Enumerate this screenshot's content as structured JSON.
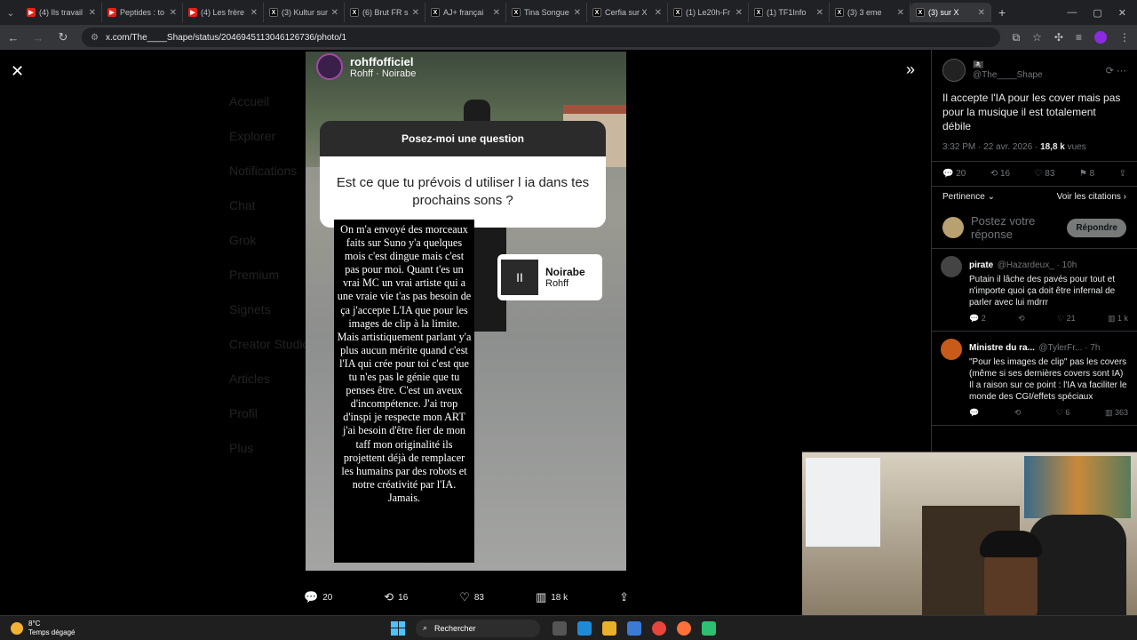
{
  "browser": {
    "tabs": [
      {
        "title": "(4) Ils travail",
        "icon": "youtube-icon"
      },
      {
        "title": "Peptides : to",
        "icon": "youtube-icon"
      },
      {
        "title": "(4) Les frère",
        "icon": "youtube-icon"
      },
      {
        "title": "(3) Kultur sur",
        "icon": "x-icon"
      },
      {
        "title": "(6) Brut FR s",
        "icon": "x-icon"
      },
      {
        "title": "AJ+ françai",
        "icon": "x-icon"
      },
      {
        "title": "Tina Songue",
        "icon": "x-icon"
      },
      {
        "title": "Cerfia sur X",
        "icon": "x-icon"
      },
      {
        "title": "(1) Le20h-Fr",
        "icon": "x-icon"
      },
      {
        "title": "(1) TF1Info",
        "icon": "x-icon"
      },
      {
        "title": "(3) 3 eme",
        "icon": "x-icon"
      },
      {
        "title": "(3) sur X",
        "icon": "x-icon",
        "active": true
      }
    ],
    "url": "x.com/The____Shape/status/2046945113046126736/photo/1"
  },
  "background_nav": [
    "Accueil",
    "Explorer",
    "Notifications",
    "Chat",
    "Grok",
    "Premium",
    "Signets",
    "Creator Studio",
    "Articles",
    "Profil",
    "Plus"
  ],
  "media": {
    "ig_user": "rohffofficiel",
    "ig_song_line": "Rohff · Noirabe",
    "question_header": "Posez-moi une question",
    "question": "Est ce que tu prévois d utiliser l ia dans tes prochains sons ?",
    "answer": "On m'a envoyé des morceaux faits sur Suno y'a quelques mois c'est dingue mais c'est pas pour moi. Quant t'es un vrai MC un vrai artiste qui a une vraie vie t'as pas besoin de ça j'accepte L'IA que pour les images de clip à la limite. Mais artistiquement parlant y'a plus aucun mérite quand c'est l'IA qui crée pour toi c'est que tu n'es pas le génie que tu penses être. C'est un aveux d'incompétence. J'ai trop d'inspi je respecte mon ART j'ai besoin d'être fier de mon taff mon originalité ils projettent déjà de remplacer les humains par des robots et notre créativité par l'IA. Jamais.",
    "song_title": "Noirabe",
    "song_artist": "Rohff"
  },
  "media_actions": {
    "replies": "20",
    "reposts": "16",
    "likes": "83",
    "views": "18 k"
  },
  "post": {
    "author_name": "🏴‍☠️",
    "author_handle": "@The____Shape",
    "text": "Il accepte l'IA pour les cover mais pas pour la musique il est totalement débile",
    "time": "3:32 PM · 22 avr. 2026 · ",
    "views": "18,8 k",
    "views_label": " vues",
    "stats": {
      "replies": "20",
      "reposts": "16",
      "likes": "83",
      "bookmarks": "8"
    },
    "sort_label": "Pertinence",
    "quotes_label": "Voir les citations",
    "compose_placeholder": "Postez votre réponse",
    "reply_button": "Répondre"
  },
  "replies": [
    {
      "name": "pirate",
      "handle": "@Hazardeux_ · 10h",
      "text": "Putain il lâche des pavés pour tout et n'importe quoi ça doit être infernal de parler avec lui mdrrr",
      "stats": [
        "2",
        "",
        "21",
        "1 k"
      ],
      "color": "#444"
    },
    {
      "name": "Ministre du ra...",
      "handle": "@TylerFr... · 7h",
      "text": "\"Pour les images de clip\" pas les covers (même si ses dernières covers sont IA)\nIl a raison sur ce point : l'IA va faciliter le monde des CGI/effets spéciaux",
      "stats": [
        "",
        "",
        "6",
        "363"
      ],
      "color": "#c85a1a"
    }
  ],
  "taskbar": {
    "temp": "8°C",
    "weather": "Temps dégagé",
    "search": "Rechercher"
  }
}
